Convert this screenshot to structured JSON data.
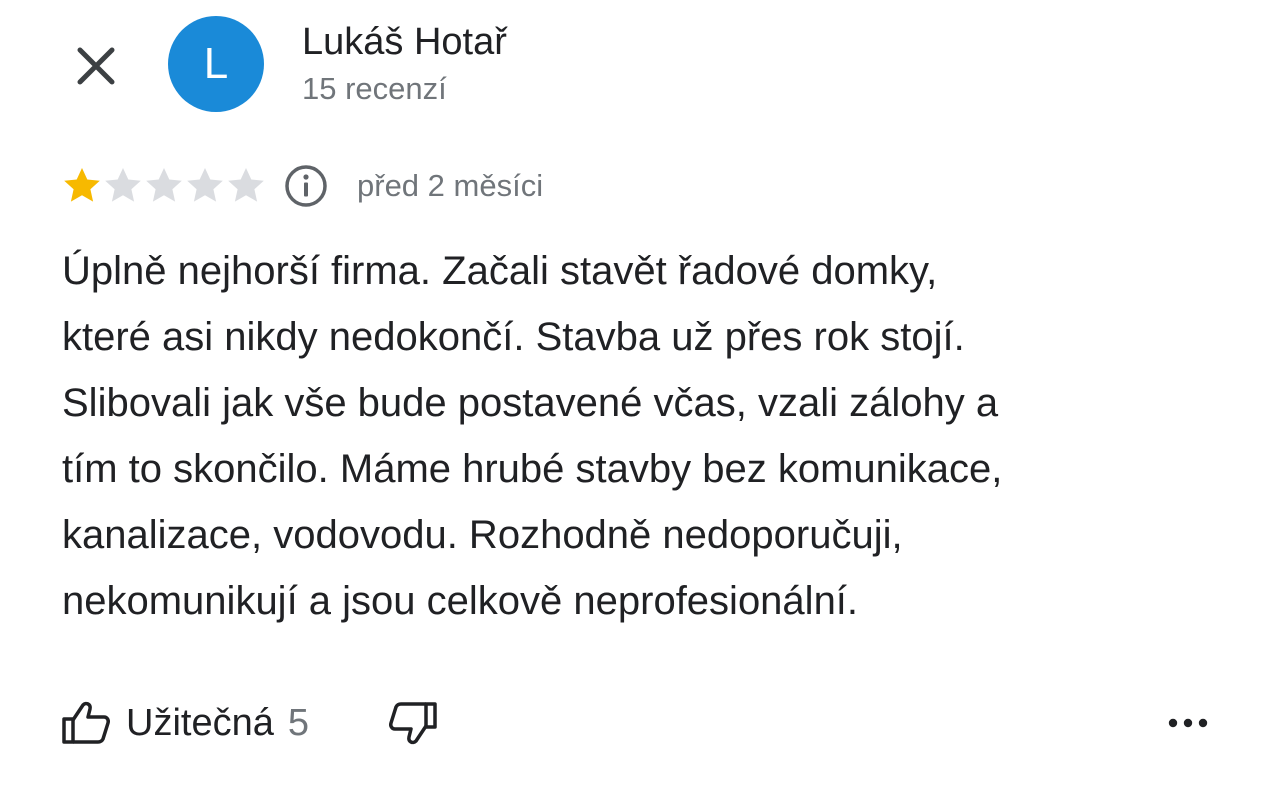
{
  "header": {
    "close_icon": "close-icon",
    "avatar_letter": "L",
    "avatar_color": "#1a8ad8",
    "reviewer_name": "Lukáš Hotař",
    "review_count": "15 recenzí"
  },
  "rating": {
    "stars": 1,
    "max_stars": 5,
    "filled_color": "#f7b900",
    "empty_color": "#dadce0",
    "info_icon": "info-icon",
    "date": "před 2 měsíci"
  },
  "review": {
    "lines": [
      "Úplně nejhorší firma. Začali stavět řadové domky,",
      "které asi nikdy nedokončí. Stavba už přes rok stojí.",
      "Slibovali jak vše bude postavené včas, vzali zálohy a",
      "tím to skončilo. Máme hrubé stavby bez komunikace,",
      "kanalizace, vodovodu. Rozhodně nedoporučuji,",
      "nekomunikují a jsou celkově neprofesionální."
    ]
  },
  "actions": {
    "helpful_label": "Užitečná",
    "helpful_count": "5",
    "thumbs_up_icon": "thumbs-up-icon",
    "thumbs_down_icon": "thumbs-down-icon",
    "more_icon": "more-horizontal-icon"
  }
}
